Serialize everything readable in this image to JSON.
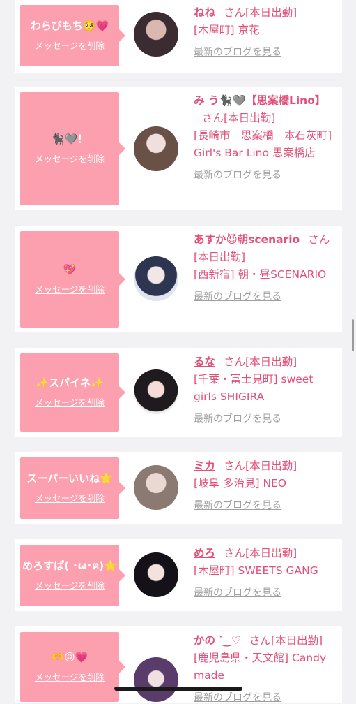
{
  "common": {
    "delete_label": "メッセージを削除",
    "blog_label": "最新のブログを見る",
    "san_label": "さん"
  },
  "colors": {
    "accent": "#fc9fae",
    "name_text": "#e34f78",
    "link_gray": "#a0a0a0",
    "background": "#f2f2f4"
  },
  "cards": [
    {
      "message": "わらびもち🥺💗",
      "name": "ねね",
      "status": "[本日出勤]",
      "shop": "[木屋町] 京花",
      "avatar": "avatar-photo-nene"
    },
    {
      "message": "🐈‍⬛🩶！",
      "name": "み う🐈‍⬛🩶【思案橋Lino】",
      "status": "[本日出勤]",
      "shop": "[長崎市　思案橋　本石灰町] Girl's Bar Lino 思案橋店",
      "avatar": "avatar-photo-miu"
    },
    {
      "message": "💖",
      "name": "あすか😈朝scenario",
      "status": "[本日出勤]",
      "shop": "[西新宿] 朝・昼SCENARIO",
      "avatar": "avatar-photo-asuka"
    },
    {
      "message": "✨スパイネ✨",
      "name": "るな",
      "status": "[本日出勤]",
      "shop": "[千葉・富士見町] sweet girls SHIGIRA",
      "avatar": "avatar-photo-runa"
    },
    {
      "message": "スーパーいいね🌟",
      "name": "ミカ",
      "status": "[本日出勤]",
      "shop": "[岐阜 多治見] NEO",
      "avatar": "avatar-photo-mika"
    },
    {
      "message": "めろすぱ( ･ω･ฅ)⭐️",
      "name": "めろ",
      "status": "[本日出勤]",
      "shop": "[木屋町] SWEETS GANG",
      "avatar": "avatar-photo-mero"
    },
    {
      "message": "🫶😖💗",
      "name": "かの ᐝ‿♡",
      "status": "[本日出勤]",
      "shop": "[鹿児島県・天文館] Candy made",
      "avatar": "avatar-photo-kano"
    }
  ]
}
